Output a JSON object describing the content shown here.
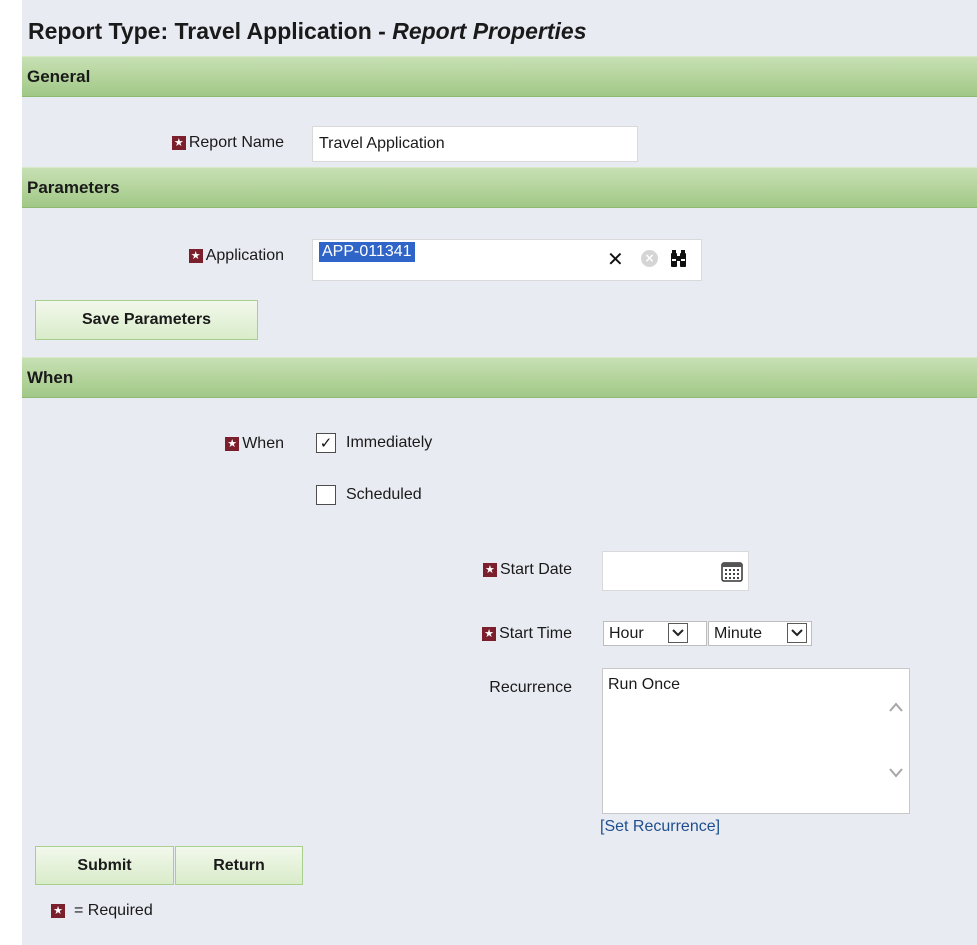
{
  "title": {
    "prefix": "Report Type: Travel Application - ",
    "italic": "Report Properties"
  },
  "sections": {
    "general": "General",
    "parameters": "Parameters",
    "when": "When"
  },
  "general": {
    "report_name_label": "Report Name",
    "report_name_value": "Travel Application"
  },
  "parameters": {
    "application_label": "Application",
    "application_value": "APP-011341",
    "clear_glyph": "✕",
    "save_button": "Save Parameters"
  },
  "when": {
    "when_label": "When",
    "immediately_label": "Immediately",
    "immediately_checked": true,
    "scheduled_label": "Scheduled",
    "scheduled_checked": false,
    "start_date_label": "Start Date",
    "start_date_value": "",
    "start_time_label": "Start Time",
    "hour_value": "Hour",
    "minute_value": "Minute",
    "recurrence_label": "Recurrence",
    "recurrence_value": "Run Once",
    "set_recurrence_link": "[Set Recurrence]"
  },
  "actions": {
    "submit": "Submit",
    "return": "Return"
  },
  "legend": {
    "required_text": "= Required"
  },
  "icons": {
    "required": "required-star-icon",
    "clear": "close-icon",
    "clear_circle": "clear-circle-icon",
    "lookup": "binoculars-icon",
    "calendar": "calendar-icon",
    "dropdown": "chevron-down-icon"
  },
  "colors": {
    "header_green": "#b2d39a",
    "button_green": "#d9ecc9",
    "required_maroon": "#7a1f2b",
    "link_blue": "#1e4f8c",
    "selection_blue": "#2f64c8",
    "page_bg": "#e9ebf3"
  }
}
